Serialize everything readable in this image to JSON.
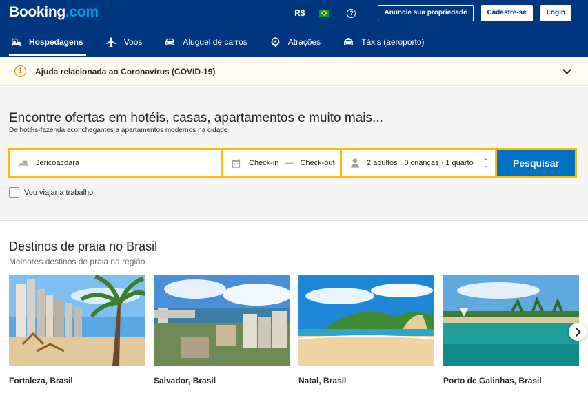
{
  "header": {
    "logo_main": "Booking",
    "logo_suffix": ".com",
    "currency": "R$",
    "flag_icon": "brazil-flag-icon",
    "help_icon": "question-circle-icon",
    "list_property_label": "Anuncie sua propriedade",
    "register_label": "Cadastre-se",
    "login_label": "Login"
  },
  "nav": {
    "items": [
      {
        "label": "Hospedagens",
        "icon": "bed-icon",
        "active": true
      },
      {
        "label": "Voos",
        "icon": "airplane-icon",
        "active": false
      },
      {
        "label": "Aluguel de carros",
        "icon": "car-icon",
        "active": false
      },
      {
        "label": "Atrações",
        "icon": "ferris-wheel-icon",
        "active": false
      },
      {
        "label": "Táxis (aeroporto)",
        "icon": "taxi-icon",
        "active": false
      }
    ]
  },
  "covid": {
    "text": "Ajuda relacionada ao Coronavírus (COVID-19)",
    "icon": "info-circle-icon"
  },
  "search": {
    "title": "Encontre ofertas em hotéis, casas, apartamentos e muito mais...",
    "subtitle": "De hotéis-fazenda aconchegantes a apartamentos modernos na cidade",
    "destination_value": "Jericoacoara",
    "checkin_label": "Check-in",
    "date_separator": "—",
    "checkout_label": "Check-out",
    "guests_summary": "2 adultos · 0 crianças · 1 quarto",
    "search_button": "Pesquisar",
    "work_trip_label": "Vou viajar a trabalho"
  },
  "destinations": {
    "title": "Destinos de praia no Brasil",
    "subtitle": "Melhores destinos de praia na região",
    "cards": [
      {
        "label": "Fortaleza, Brasil"
      },
      {
        "label": "Salvador, Brasil"
      },
      {
        "label": "Natal, Brasil"
      },
      {
        "label": "Porto de Galinhas, Brasil"
      }
    ]
  },
  "colors": {
    "brand_blue": "#003580",
    "search_yellow": "#febb02",
    "search_button": "#0071c2"
  }
}
